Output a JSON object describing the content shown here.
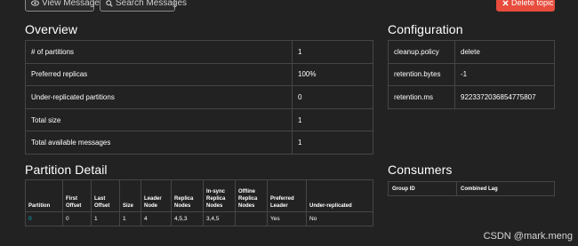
{
  "toolbar": {
    "view_messages": "View Messages",
    "search_messages": "Search Messages",
    "delete_topic": "Delete topic"
  },
  "overview": {
    "title": "Overview",
    "rows": [
      {
        "label": "# of partitions",
        "value": "1"
      },
      {
        "label": "Preferred replicas",
        "value": "100%"
      },
      {
        "label": "Under-replicated partitions",
        "value": "0"
      },
      {
        "label": "Total size",
        "value": "1"
      },
      {
        "label": "Total available messages",
        "value": "1"
      }
    ]
  },
  "configuration": {
    "title": "Configuration",
    "rows": [
      {
        "key": "cleanup.policy",
        "value": "delete"
      },
      {
        "key": "retention.bytes",
        "value": "-1"
      },
      {
        "key": "retention.ms",
        "value": "9223372036854775807"
      }
    ]
  },
  "partition_detail": {
    "title": "Partition Detail",
    "headers": [
      "Partition",
      "First Offset",
      "Last Offset",
      "Size",
      "Leader Node",
      "Replica Nodes",
      "In-sync Replica Nodes",
      "Offline Replica Nodes",
      "Preferred Leader",
      "Under-replicated"
    ],
    "rows": [
      [
        "0",
        "0",
        "1",
        "1",
        "4",
        "4,5,3",
        "3,4,5",
        "",
        "Yes",
        "No"
      ]
    ]
  },
  "consumers": {
    "title": "Consumers",
    "headers": [
      "Group ID",
      "Combined Lag"
    ]
  },
  "watermark": "CSDN @mark.meng",
  "colors": {
    "background": "#222222",
    "border": "#464646",
    "danger": "#e74c3c",
    "link": "#00bcd4"
  },
  "icons": {
    "view": "eye-icon",
    "search": "search-icon",
    "delete": "close-icon"
  }
}
